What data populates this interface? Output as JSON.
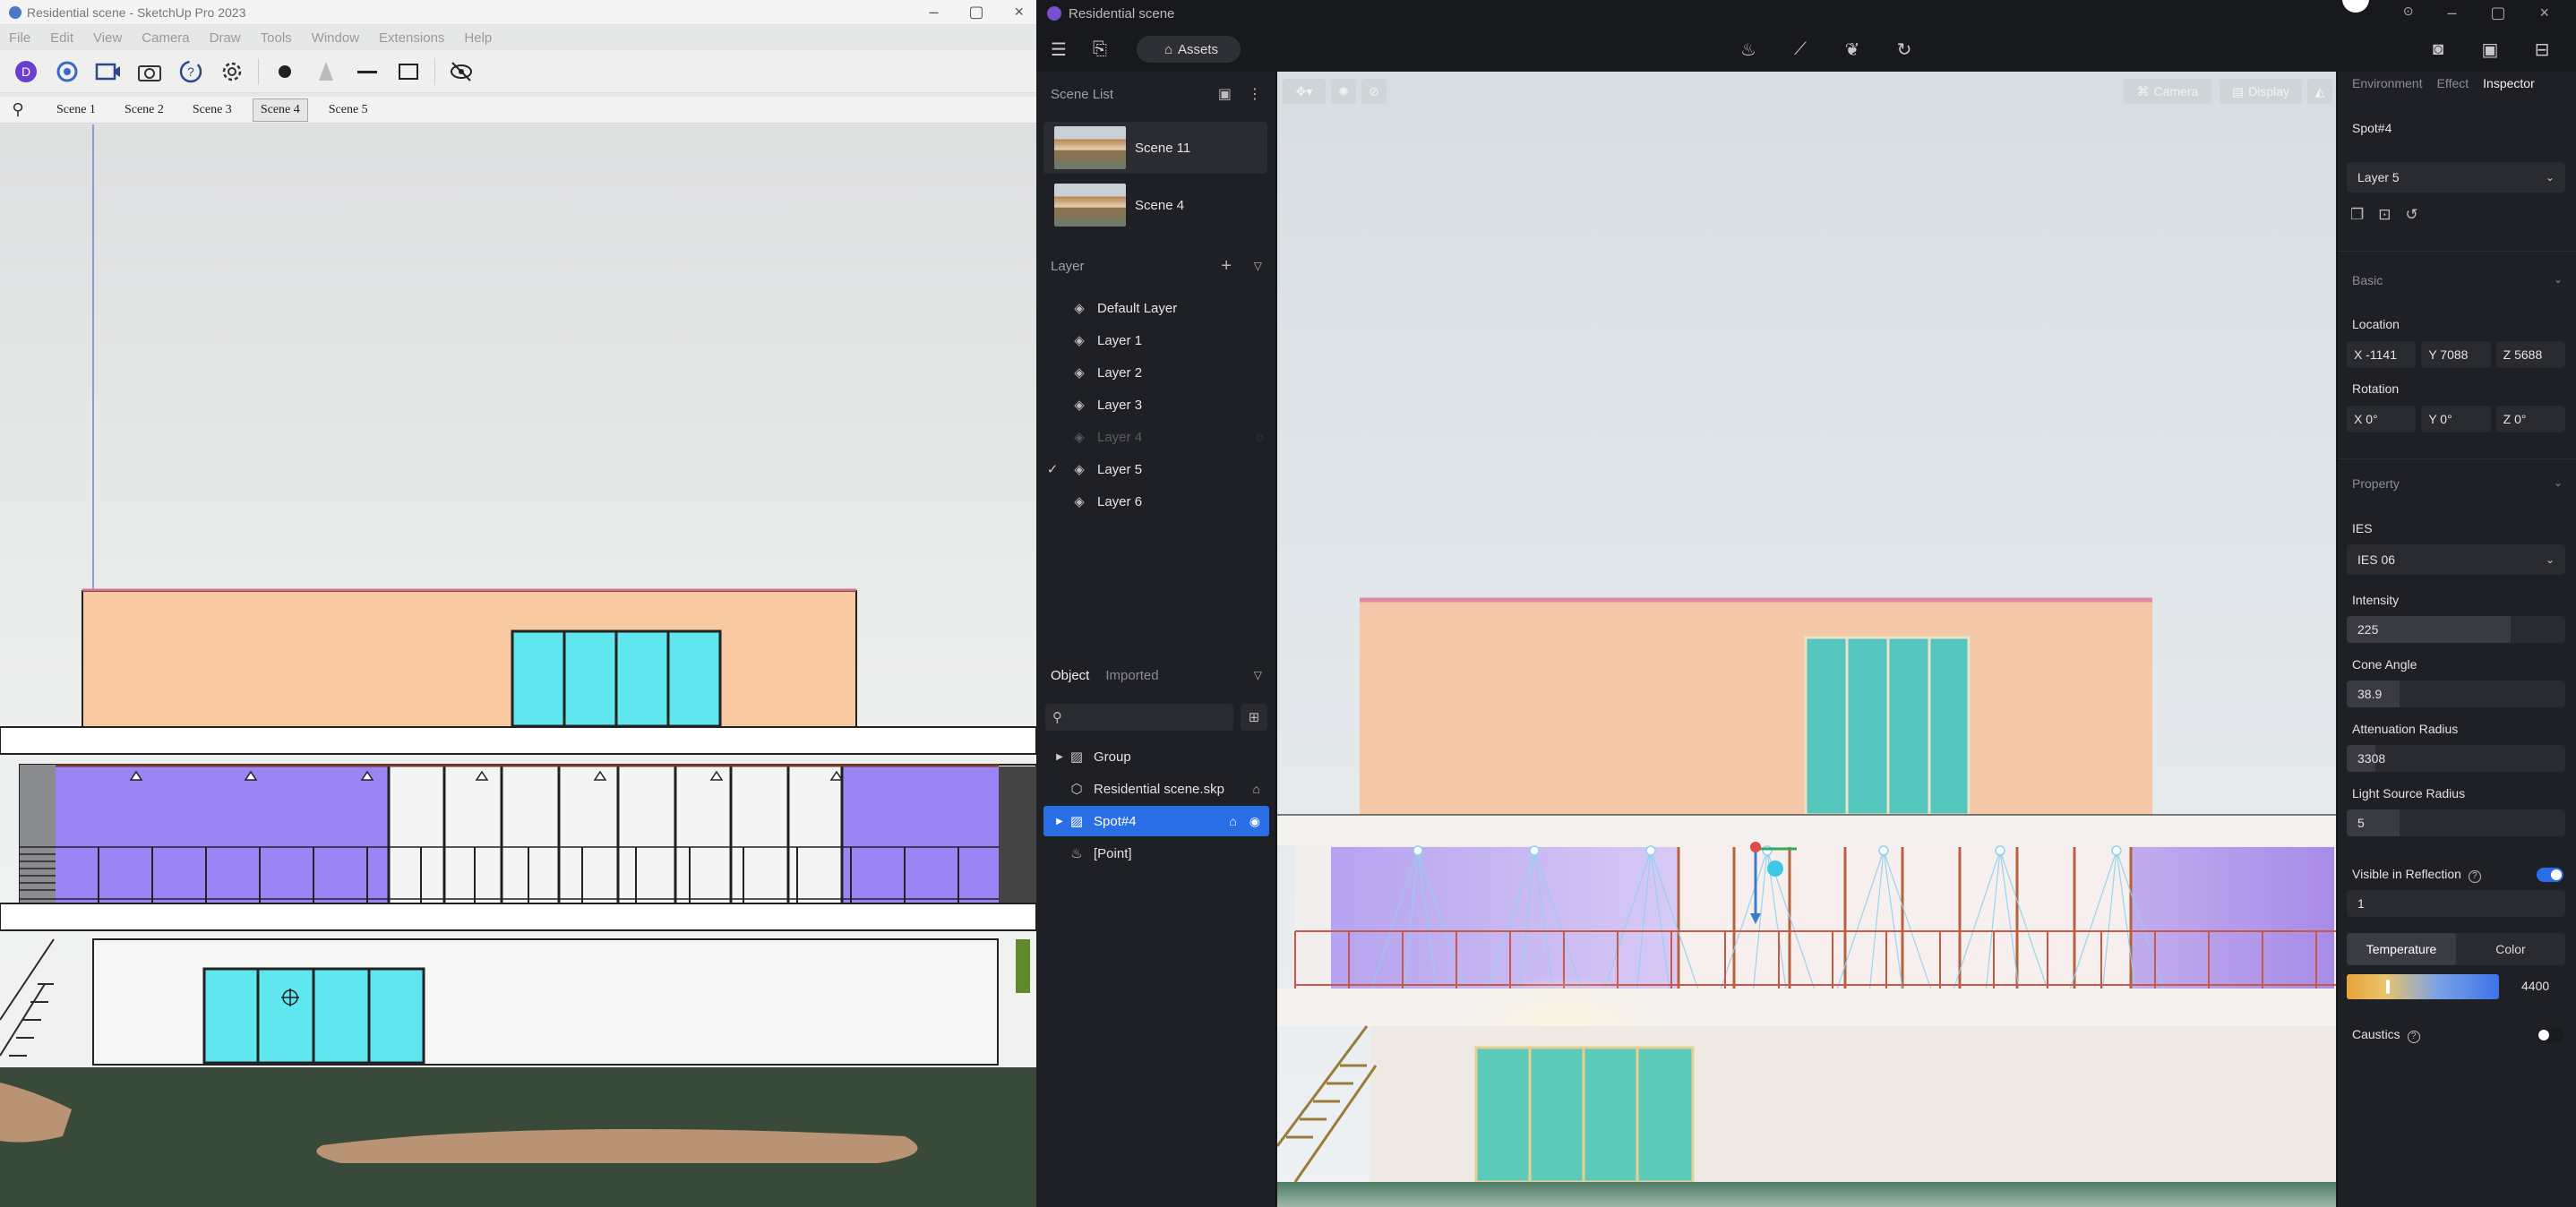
{
  "sketchup": {
    "title": "Residential scene - SketchUp Pro 2023",
    "menu": [
      "File",
      "Edit",
      "View",
      "Camera",
      "Draw",
      "Tools",
      "Window",
      "Extensions",
      "Help"
    ],
    "scene_tabs": [
      "Scene 1",
      "Scene 2",
      "Scene 3",
      "Scene 4",
      "Scene 5"
    ],
    "active_scene": "Scene 4"
  },
  "d5": {
    "title": "Residential scene",
    "assets_label": "Assets",
    "scene_list": {
      "title": "Scene List",
      "items": [
        {
          "label": "Scene 11",
          "active": true
        },
        {
          "label": "Scene 4",
          "active": false
        }
      ]
    },
    "layers": {
      "title": "Layer",
      "items": [
        {
          "label": "Default Layer",
          "checked": false,
          "hidden": false
        },
        {
          "label": "Layer 1",
          "checked": false,
          "hidden": false
        },
        {
          "label": "Layer 2",
          "checked": false,
          "hidden": false
        },
        {
          "label": "Layer 3",
          "checked": false,
          "hidden": false
        },
        {
          "label": "Layer 4",
          "checked": false,
          "hidden": true
        },
        {
          "label": "Layer 5",
          "checked": true,
          "hidden": false
        },
        {
          "label": "Layer 6",
          "checked": false,
          "hidden": false
        }
      ]
    },
    "objects": {
      "tab_object": "Object",
      "tab_imported": "Imported",
      "search_placeholder": "",
      "items": [
        {
          "label": "Group",
          "selected": false
        },
        {
          "label": "Residential scene.skp",
          "selected": false
        },
        {
          "label": "Spot#4",
          "selected": true
        },
        {
          "label": "[Point]",
          "selected": false
        }
      ]
    },
    "viewport": {
      "camera_label": "Camera",
      "display_label": "Display"
    },
    "inspector": {
      "tabs": [
        "Environment",
        "Effect",
        "Inspector"
      ],
      "active_tab": "Inspector",
      "object_name": "Spot#4",
      "layer": "Layer 5",
      "basic_title": "Basic",
      "location_label": "Location",
      "location": {
        "x": "X -1141",
        "y": "Y 7088",
        "z": "Z 5688"
      },
      "rotation_label": "Rotation",
      "rotation": {
        "x": "X 0°",
        "y": "Y 0°",
        "z": "Z 0°"
      },
      "property_title": "Property",
      "ies_label": "IES",
      "ies_value": "IES 06",
      "intensity_label": "Intensity",
      "intensity": "225",
      "intensity_fraction": 0.75,
      "cone_angle_label": "Cone Angle",
      "cone_angle": "38.9",
      "cone_angle_fraction": 0.24,
      "attenuation_label": "Attenuation Radius",
      "attenuation": "3308",
      "attenuation_fraction": 0.13,
      "light_source_label": "Light Source Radius",
      "light_source": "5",
      "light_source_fraction": 0.24,
      "visible_reflection_label": "Visible in Reflection",
      "visible_reflection_value": "1",
      "visible_reflection_on": true,
      "temperature_label": "Temperature",
      "color_label": "Color",
      "temperature_value": "4400",
      "caustics_label": "Caustics",
      "caustics_on": false
    }
  }
}
